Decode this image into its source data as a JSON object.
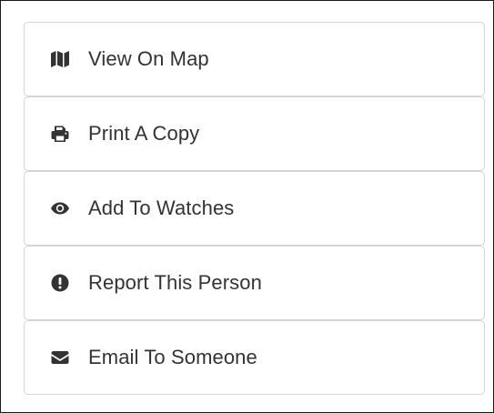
{
  "actions": {
    "items": [
      {
        "label": "View On Map",
        "icon": "map-icon"
      },
      {
        "label": "Print A Copy",
        "icon": "print-icon"
      },
      {
        "label": "Add To Watches",
        "icon": "eye-icon"
      },
      {
        "label": "Report This Person",
        "icon": "exclamation-circle-icon"
      },
      {
        "label": "Email To Someone",
        "icon": "envelope-icon"
      }
    ]
  },
  "colors": {
    "text": "#333333",
    "border": "#d4d4d4",
    "icon": "#333333"
  }
}
